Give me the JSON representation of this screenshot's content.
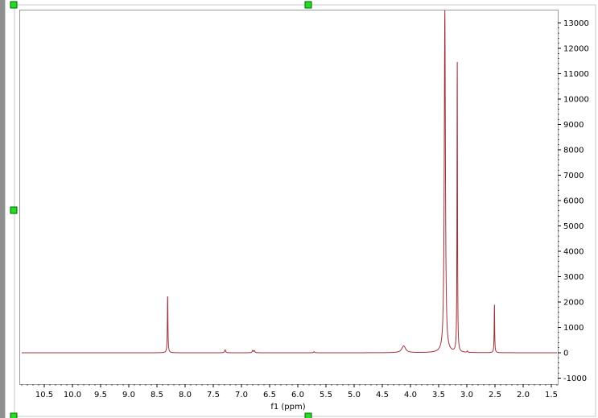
{
  "chart_data": {
    "type": "line",
    "xlabel": "f1 (ppm)",
    "ylabel": "",
    "xlim": [
      10.9,
      1.4
    ],
    "ylim": [
      -1200,
      13500
    ],
    "x_ticks": [
      10.5,
      10.0,
      9.5,
      9.0,
      8.5,
      8.0,
      7.5,
      7.0,
      6.5,
      6.0,
      5.5,
      5.0,
      4.5,
      4.0,
      3.5,
      3.0,
      2.5,
      2.0,
      1.5
    ],
    "x_tick_labels": [
      "10.5",
      "10.0",
      "9.5",
      "9.0",
      "8.5",
      "8.0",
      "7.5",
      "7.0",
      "6.5",
      "6.0",
      "5.5",
      "5.0",
      "4.5",
      "4.0",
      "3.5",
      "3.0",
      "2.5",
      "2.0",
      "1.5"
    ],
    "y_ticks": [
      13000,
      12000,
      11000,
      10000,
      9000,
      8000,
      7000,
      6000,
      5000,
      4000,
      3000,
      2000,
      1000,
      0,
      -1000
    ],
    "y_tick_labels": [
      "13000",
      "12000",
      "11000",
      "10000",
      "9000",
      "8000",
      "7000",
      "6000",
      "5000",
      "4000",
      "3000",
      "2000",
      "1000",
      "0",
      "-1000"
    ],
    "line_color": "#a0303a",
    "grid": false,
    "series": [
      {
        "peaks": [
          {
            "x": 8.31,
            "height": 2300,
            "width": 0.006
          },
          {
            "x": 7.29,
            "height": 120,
            "width": 0.01
          },
          {
            "x": 6.8,
            "height": 90,
            "width": 0.01
          },
          {
            "x": 6.77,
            "height": 80,
            "width": 0.01
          },
          {
            "x": 5.71,
            "height": 40,
            "width": 0.01
          },
          {
            "x": 4.12,
            "height": 270,
            "width": 0.04
          },
          {
            "x": 3.39,
            "height": 13500,
            "width": 0.012
          },
          {
            "x": 3.17,
            "height": 11600,
            "width": 0.005
          },
          {
            "x": 2.99,
            "height": 50,
            "width": 0.008
          },
          {
            "x": 2.51,
            "height": 1950,
            "width": 0.005
          }
        ]
      }
    ]
  },
  "handles": {
    "color": "#22dd22",
    "border": "#006600"
  }
}
